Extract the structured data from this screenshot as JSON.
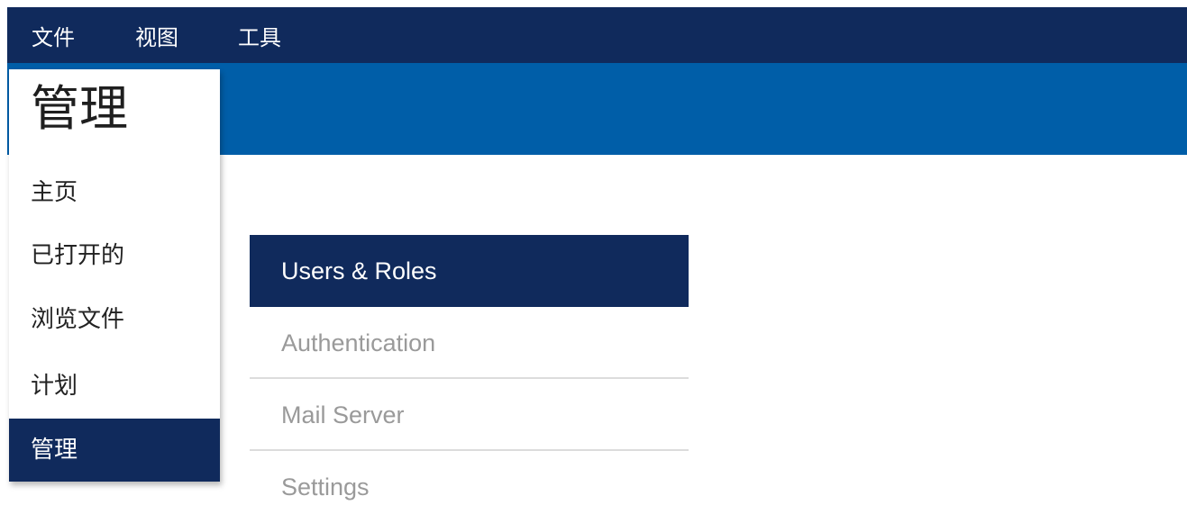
{
  "menubar": {
    "items": [
      {
        "label": "文件"
      },
      {
        "label": "视图"
      },
      {
        "label": "工具"
      }
    ]
  },
  "sidenav": {
    "title": "管理",
    "items": [
      {
        "label": "主页",
        "active": false
      },
      {
        "label": "已打开的",
        "active": false
      },
      {
        "label": "浏览文件",
        "active": false
      },
      {
        "label": "计划",
        "active": false
      },
      {
        "label": "管理",
        "active": true
      }
    ]
  },
  "tabs": {
    "items": [
      {
        "label": "Users & Roles",
        "active": true
      },
      {
        "label": "Authentication",
        "active": false
      },
      {
        "label": "Mail Server",
        "active": false
      },
      {
        "label": "Settings",
        "active": false
      }
    ]
  },
  "colors": {
    "menubar_bg": "#102a5c",
    "banner_bg": "#005ea8",
    "active_bg": "#102a5c",
    "inactive_tab_text": "#9a9a9a"
  }
}
